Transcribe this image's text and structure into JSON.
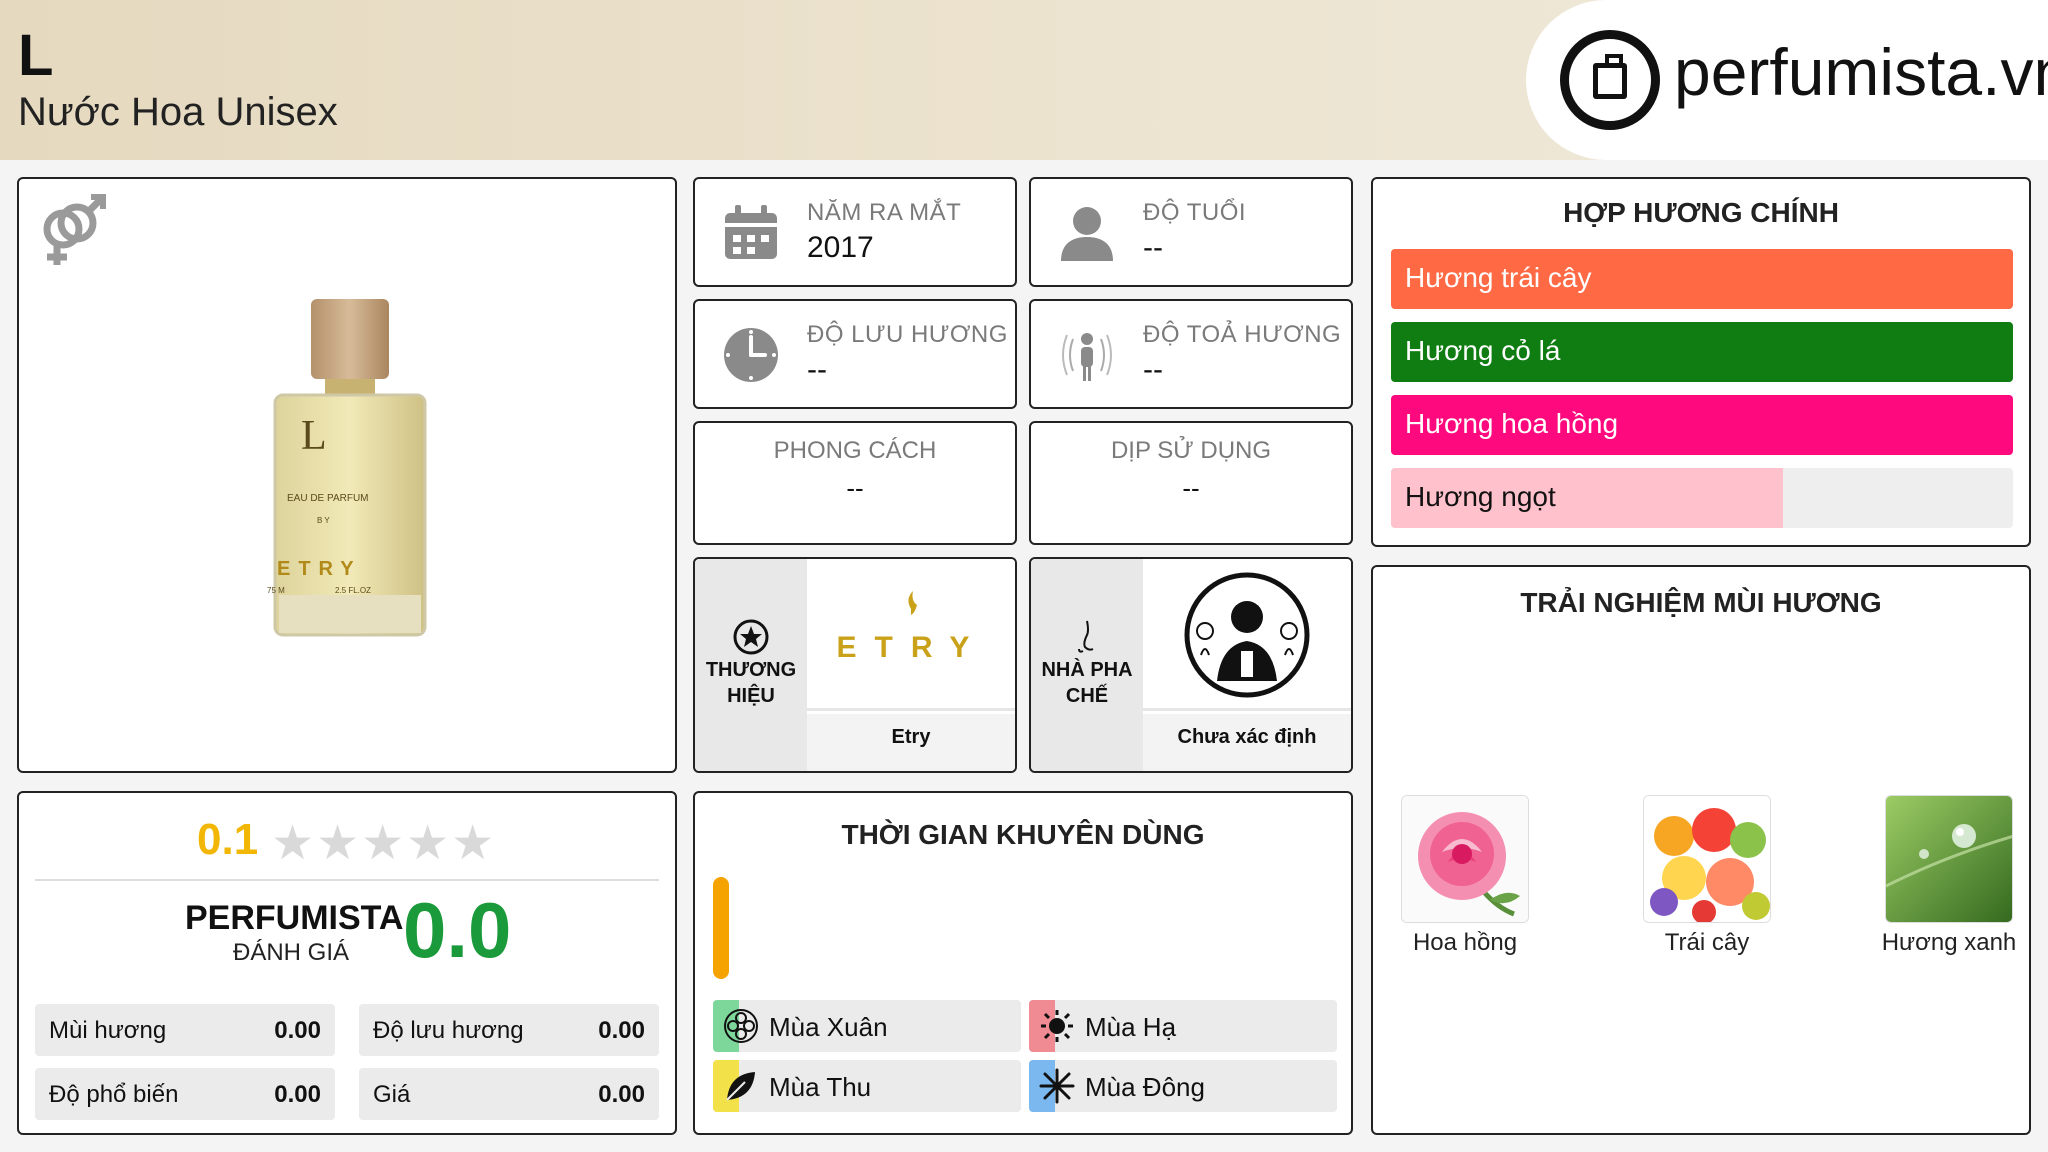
{
  "header": {
    "title": "L",
    "subtitle": "Nước Hoa Unisex",
    "logo_text": "perfumista.vn"
  },
  "info": {
    "launch_label": "NĂM RA MẮT",
    "launch_value": "2017",
    "age_label": "ĐỘ TUỔI",
    "age_value": "--",
    "longevity_label": "ĐỘ LƯU HƯƠNG",
    "longevity_value": "--",
    "sillage_label": "ĐỘ TOẢ HƯƠNG",
    "sillage_value": "--",
    "style_label": "PHONG CÁCH",
    "style_value": "--",
    "occasion_label": "DỊP SỬ DỤNG",
    "occasion_value": "--"
  },
  "brand": {
    "side_label": "THƯƠNG HIỆU",
    "logo_text": "ETRY",
    "name": "Etry"
  },
  "perfumer": {
    "side_label": "NHÀ PHA CHẾ",
    "name": "Chưa xác định"
  },
  "bottle": {
    "letter": "L",
    "line1": "EAU DE PARFUM",
    "line2": "B Y",
    "brand": "ETRY",
    "vol_left": "75 M",
    "vol_right": "2.5 FL.OZ"
  },
  "accords": {
    "title": "HỢP HƯƠNG CHÍNH",
    "items": [
      {
        "label": "Hương trái cây",
        "color": "#ff6a45",
        "level": 1.0
      },
      {
        "label": "Hương cỏ lá",
        "color": "#0f7d12",
        "level": 1.0
      },
      {
        "label": "Hương hoa hồng",
        "color": "#ff0a7e",
        "level": 1.0
      },
      {
        "label": "Hương ngọt",
        "color": "#ffc1cb",
        "level": 0.63
      }
    ]
  },
  "notes": {
    "title": "TRẢI NGHIỆM MÙI HƯƠNG",
    "items": [
      {
        "label": "Hoa hồng",
        "icon": "rose-icon"
      },
      {
        "label": "Trái cây",
        "icon": "fruit-icon"
      },
      {
        "label": "Hương xanh",
        "icon": "green-leaf-icon"
      }
    ]
  },
  "rating": {
    "score": "0.1",
    "stars_total": 5,
    "stars_filled": 0,
    "perfumista_title": "PERFUMISTA",
    "perfumista_sub": "ĐÁNH GIÁ",
    "perfumista_score": "0.0",
    "stats": [
      {
        "label": "Mùi hương",
        "value": "0.00"
      },
      {
        "label": "Độ lưu hương",
        "value": "0.00"
      },
      {
        "label": "Độ phổ biến",
        "value": "0.00"
      },
      {
        "label": "Giá",
        "value": "0.00"
      }
    ]
  },
  "seasons": {
    "title": "THỜI GIAN KHUYÊN DÙNG",
    "items": [
      {
        "label": "Mùa Xuân",
        "color": "#7ed79a"
      },
      {
        "label": "Mùa Hạ",
        "color": "#f08a93"
      },
      {
        "label": "Mùa Thu",
        "color": "#f3e14a"
      },
      {
        "label": "Mùa Đông",
        "color": "#7ab8ef"
      }
    ]
  },
  "colors": {
    "rating_yellow": "#f2b705",
    "score_green": "#1a9a3a",
    "time_bar": "#f5a300"
  }
}
